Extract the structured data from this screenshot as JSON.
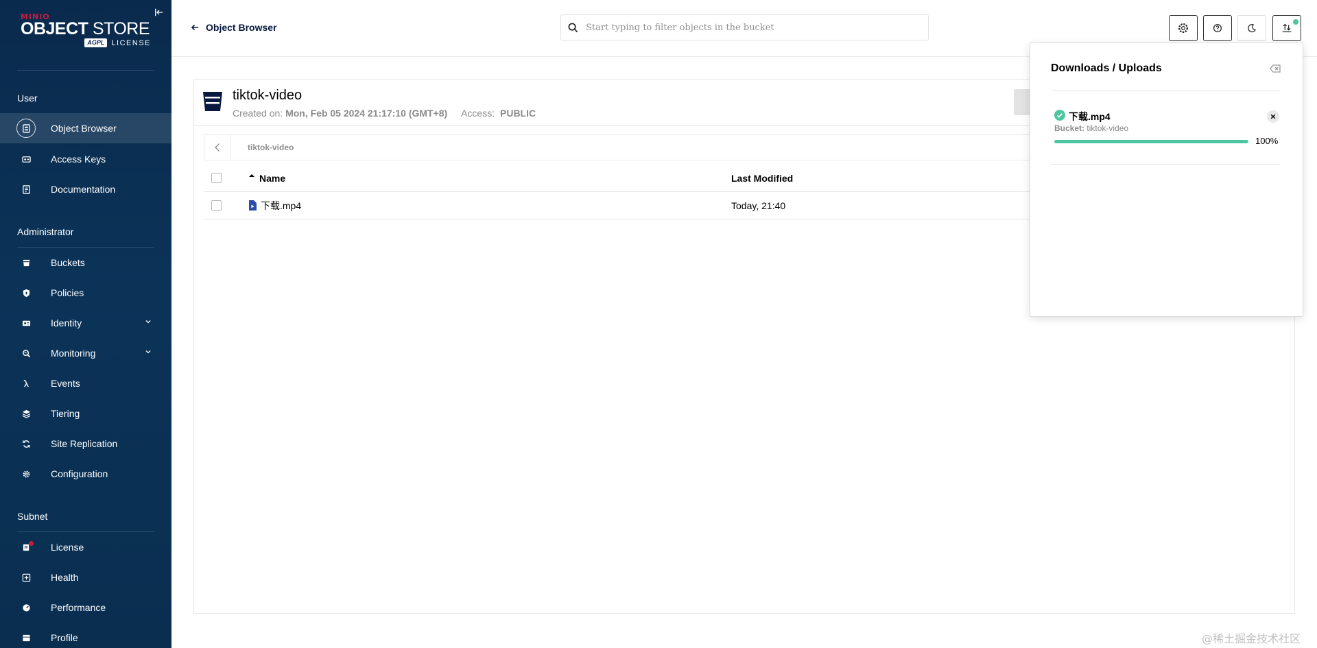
{
  "brand": {
    "minio": "MINIO",
    "product_bold": "OBJECT",
    "product_thin": "STORE",
    "agpl": "AGPL",
    "license": "LICENSE"
  },
  "sidebar": {
    "sections": [
      {
        "title": "User",
        "items": [
          {
            "label": "Object Browser",
            "icon": "object-browser-icon",
            "active": true
          },
          {
            "label": "Access Keys",
            "icon": "access-keys-icon"
          },
          {
            "label": "Documentation",
            "icon": "documentation-icon"
          }
        ]
      },
      {
        "title": "Administrator",
        "items": [
          {
            "label": "Buckets",
            "icon": "bucket-icon"
          },
          {
            "label": "Policies",
            "icon": "policy-icon"
          },
          {
            "label": "Identity",
            "icon": "identity-icon",
            "expandable": true
          },
          {
            "label": "Monitoring",
            "icon": "monitoring-icon",
            "expandable": true
          },
          {
            "label": "Events",
            "icon": "lambda-icon"
          },
          {
            "label": "Tiering",
            "icon": "tiering-icon"
          },
          {
            "label": "Site Replication",
            "icon": "replication-icon"
          },
          {
            "label": "Configuration",
            "icon": "gear-icon"
          }
        ]
      },
      {
        "title": "Subnet",
        "items": [
          {
            "label": "License",
            "icon": "license-icon",
            "badge": true
          },
          {
            "label": "Health",
            "icon": "health-icon"
          },
          {
            "label": "Performance",
            "icon": "performance-icon"
          },
          {
            "label": "Profile",
            "icon": "profile-icon"
          }
        ]
      }
    ]
  },
  "topbar": {
    "back_label": "Object Browser",
    "search_placeholder": "Start typing to filter objects in the bucket"
  },
  "bucket": {
    "name": "tiktok-video",
    "created_label": "Created on:",
    "created_value": "Mon, Feb 05 2024 21:17:10 (GMT+8)",
    "access_label": "Access:",
    "access_value": "PUBLIC",
    "breadcrumb": "tiktok-video"
  },
  "table": {
    "columns": [
      "Name",
      "Last Modified"
    ],
    "rows": [
      {
        "name": "下载.mp4",
        "modified": "Today, 21:40"
      }
    ]
  },
  "downloads": {
    "title": "Downloads / Uploads",
    "items": [
      {
        "file": "下载.mp4",
        "bucket_label": "Bucket:",
        "bucket": "tiktok-video",
        "progress": 100,
        "progress_text": "100%"
      }
    ]
  },
  "colors": {
    "sidebar_bg": "#0a2a4d",
    "accent_green": "#4cc6a0",
    "license_badge": "#c51c3f"
  },
  "watermark": "@稀土掘金技术社区"
}
